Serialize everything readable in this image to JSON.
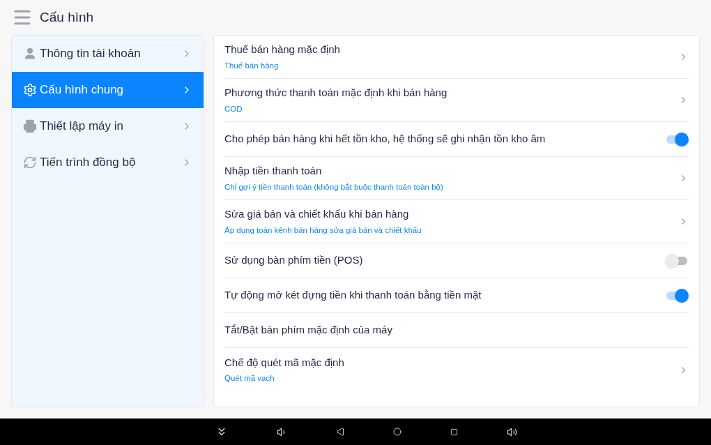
{
  "header": {
    "title": "Cấu hình"
  },
  "sidebar": {
    "items": [
      {
        "label": "Thông tin tài khoản",
        "kind": "user",
        "selected": false
      },
      {
        "label": "Cấu hình chung",
        "kind": "gear",
        "selected": true
      },
      {
        "label": "Thiết lập máy in",
        "kind": "printer",
        "selected": false
      },
      {
        "label": "Tiến trình đồng bộ",
        "kind": "sync",
        "selected": false
      }
    ]
  },
  "settings": [
    {
      "kind": "link",
      "title": "Thuế bán hàng mặc định",
      "subtitle": "Thuế bán hàng"
    },
    {
      "kind": "link",
      "title": "Phương thức thanh toán mặc định khi bán hàng",
      "subtitle": "COD"
    },
    {
      "kind": "toggle",
      "title": "Cho phép bán hàng khi hết tồn kho, hệ thống sẽ ghi nhận tồn kho âm",
      "on": true
    },
    {
      "kind": "link",
      "title": "Nhập tiền thanh toán",
      "subtitle": "Chỉ gợi ý tiền thanh toán (không bắt buộc thanh toán toàn bộ)"
    },
    {
      "kind": "link",
      "title": "Sửa giá bán và chiết khấu khi bán hàng",
      "subtitle": "Áp dụng toàn kênh bán hàng sửa giá bán và chiết khấu"
    },
    {
      "kind": "toggle",
      "title": "Sử dụng bàn phím tiền (POS)",
      "on": false
    },
    {
      "kind": "toggle",
      "title": "Tự động mở két đựng tiền khi thanh toán bằng tiền mặt",
      "on": true
    },
    {
      "kind": "plain",
      "title": "Tắt/Bật bàn phím mặc định của máy"
    },
    {
      "kind": "link",
      "title": "Chế độ quét mã mặc định",
      "subtitle": "Quét mã vạch"
    }
  ]
}
